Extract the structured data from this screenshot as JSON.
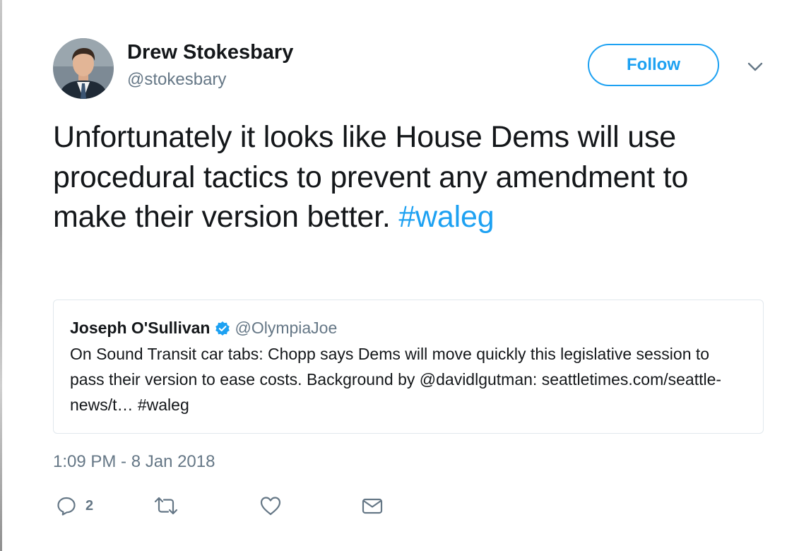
{
  "author": {
    "name": "Drew Stokesbary",
    "handle": "@stokesbary"
  },
  "follow_label": "Follow",
  "tweet": {
    "text": "Unfortunately it looks like House Dems will use procedural tactics to prevent any amendment to make their version better.",
    "hashtag": "#waleg"
  },
  "quoted_tweet": {
    "name": "Joseph O'Sullivan",
    "handle": "@OlympiaJoe",
    "verified": true,
    "text": "On Sound Transit car tabs: Chopp says Dems will move quickly this legislative session to pass their version to ease costs. Background by @davidlgutman: seattletimes.com/seattle-news/t… #waleg"
  },
  "timestamp": "1:09 PM - 8 Jan 2018",
  "actions": {
    "reply_count": "2",
    "icons": [
      "reply-icon",
      "retweet-icon",
      "like-icon",
      "direct-message-icon"
    ]
  },
  "colors": {
    "accent": "#1da1f2",
    "secondary_text": "#657786",
    "text": "#14171a",
    "border": "#e1e8ed"
  }
}
